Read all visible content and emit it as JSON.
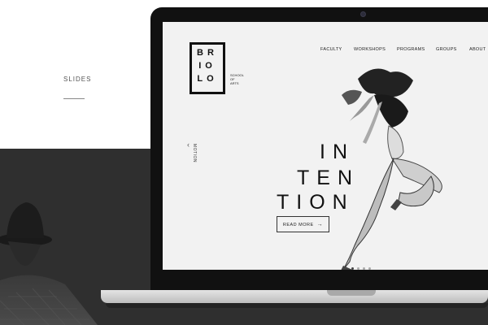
{
  "side": {
    "label": "SLIDES"
  },
  "logo": {
    "rows": [
      "BR",
      "IO",
      "LO"
    ],
    "sub": [
      "SCHOOL",
      "OF",
      "ARTS"
    ]
  },
  "nav": {
    "items": [
      "FACULTY",
      "WORKSHOPS",
      "PROGRAMS",
      "GROUPS",
      "ABOUT"
    ]
  },
  "slide": {
    "vertical_label": "MOTION",
    "headline": [
      "IN",
      "TEN",
      "TION"
    ],
    "cta": "READ MORE",
    "arrow_icon": "arrow-right-icon",
    "chevron_icon": "chevron-left-icon",
    "dots_total": 4,
    "dots_active": 1
  },
  "colors": {
    "dark_bg": "#2f2f2f",
    "screen_bg": "#f2f2f2",
    "ink": "#111111"
  }
}
